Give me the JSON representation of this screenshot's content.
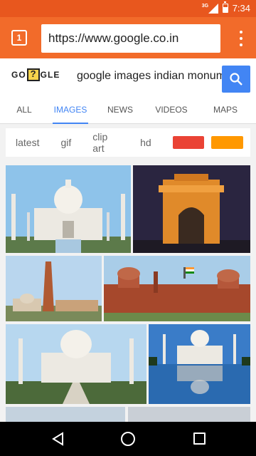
{
  "status": {
    "time": "7:34",
    "network": "3G"
  },
  "browser": {
    "tab_count": "1",
    "url": "https://www.google.co.in"
  },
  "google": {
    "logo_text_left": "GO",
    "logo_text_right": "GLE",
    "query": "google images indian monuments"
  },
  "tabs": [
    {
      "label": "ALL"
    },
    {
      "label": "IMAGES"
    },
    {
      "label": "NEWS"
    },
    {
      "label": "VIDEOS"
    },
    {
      "label": "MAPS"
    }
  ],
  "chips": {
    "latest": "latest",
    "gif": "gif",
    "clip_art": "clip art",
    "hd": "hd"
  },
  "colors": {
    "red_swatch": "#ea4335",
    "orange_swatch": "#ff9800",
    "accent": "#4285f4",
    "browser": "#f26b2a"
  },
  "images": [
    {
      "subject": "Taj Mahal"
    },
    {
      "subject": "India Gate at night"
    },
    {
      "subject": "Qutub Minar"
    },
    {
      "subject": "Red Fort"
    },
    {
      "subject": "Taj Mahal gardens"
    },
    {
      "subject": "Taj Mahal reflection"
    }
  ]
}
